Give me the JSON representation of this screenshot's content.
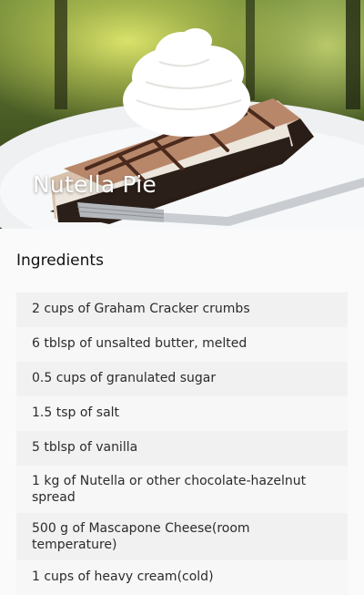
{
  "recipe": {
    "title": "Nutella Pie",
    "section_title": "Ingredients",
    "ingredients": [
      "2 cups of Graham Cracker crumbs",
      "6 tblsp of unsalted butter, melted",
      "0.5 cups of granulated sugar",
      "1.5 tsp of salt",
      "5 tblsp of vanilla",
      "1 kg of Nutella or other chocolate-hazelnut spread",
      "500 g of Mascapone Cheese(room temperature)",
      "1 cups of heavy cream(cold)"
    ]
  },
  "colors": {
    "background": "#fafafa",
    "row_odd": "#f1f1f1",
    "row_even": "#f7f7f7",
    "title_text": "#ffffff"
  }
}
